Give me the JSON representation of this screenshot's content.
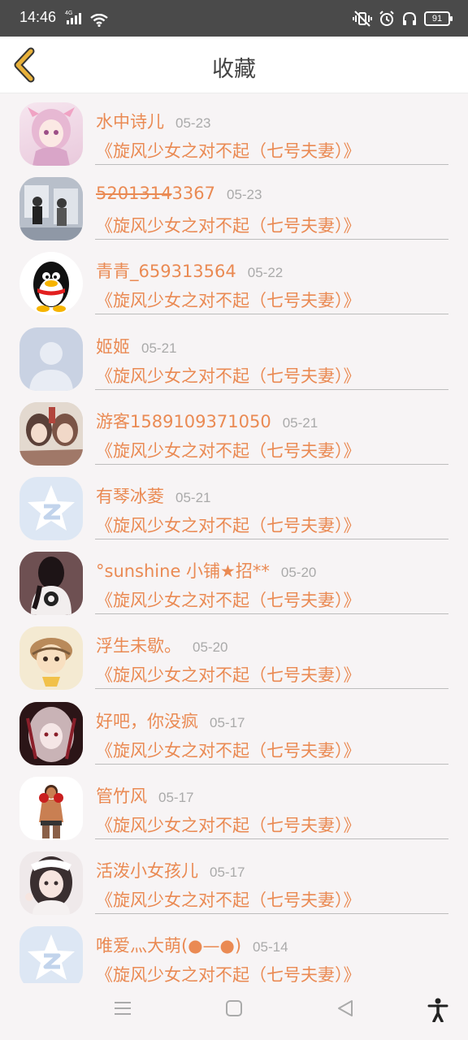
{
  "status": {
    "time": "14:46",
    "network": "4G",
    "battery": "91"
  },
  "header": {
    "title": "收藏"
  },
  "items": [
    {
      "name": "水中诗儿",
      "date": "05-23",
      "book": "《旋风少女之对不起（七号夫妻）》"
    },
    {
      "name_struck": "5201314",
      "name_rest": "3367",
      "date": "05-23",
      "book": "《旋风少女之对不起（七号夫妻）》"
    },
    {
      "name": "青青_659313564",
      "date": "05-22",
      "book": "《旋风少女之对不起（七号夫妻）》"
    },
    {
      "name": "姬姬",
      "date": "05-21",
      "book": "《旋风少女之对不起（七号夫妻）》"
    },
    {
      "name": "游客1589109371050",
      "date": "05-21",
      "book": "《旋风少女之对不起（七号夫妻）》"
    },
    {
      "name": "有琴冰菱",
      "date": "05-21",
      "book": "《旋风少女之对不起（七号夫妻）》"
    },
    {
      "name": "°sunshine 小铺★招**",
      "date": "05-20",
      "book": "《旋风少女之对不起（七号夫妻）》"
    },
    {
      "name": "浮生未歇。",
      "date": "05-20",
      "book": "《旋风少女之对不起（七号夫妻）》"
    },
    {
      "name": "好吧，你没疯",
      "date": "05-17",
      "book": "《旋风少女之对不起（七号夫妻）》"
    },
    {
      "name": "管竹风",
      "date": "05-17",
      "book": "《旋风少女之对不起（七号夫妻）》"
    },
    {
      "name": "活泼小女孩儿",
      "date": "05-17",
      "book": "《旋风少女之对不起（七号夫妻）》"
    },
    {
      "name": "唯爱灬大萌(●—●)",
      "date": "05-14",
      "book": "《旋风少女之对不起（七号夫妻）》"
    }
  ],
  "colors": {
    "accent": "#ea8a53",
    "back_arrow": "#e8b13a",
    "statusbar": "#4a4a4a"
  },
  "icons": [
    "back-arrow-icon",
    "menu-icon",
    "home-icon",
    "back-triangle-icon",
    "accessibility-icon"
  ]
}
